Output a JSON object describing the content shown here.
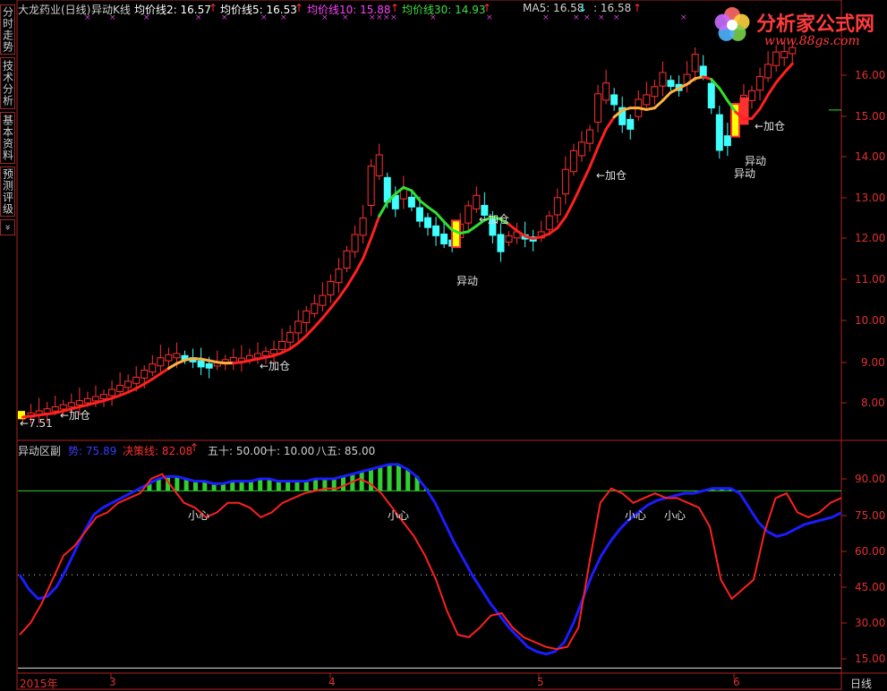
{
  "app": {
    "stock_title": "大龙药业(日线)",
    "indicator_name": "异动K线",
    "ma_values": [
      {
        "label": "均价线2: 16.57",
        "color": "#ffffff"
      },
      {
        "label": "均价线5: 16.53",
        "color": "#ffffff"
      },
      {
        "label": "均价线10: 15.88",
        "color": "#ff40ff"
      },
      {
        "label": "均价线30: 14.93",
        "color": "#40e040"
      }
    ],
    "ma5_label": "MA5: 16.58",
    "ma5_value2": ": 16.58",
    "timeframe_label": "日线"
  },
  "side_tabs": [
    {
      "label": "分时走势"
    },
    {
      "label": "技术分析"
    },
    {
      "label": "基本资料"
    },
    {
      "label": "预测评级"
    },
    {
      "label": "»"
    }
  ],
  "logo": {
    "text": "分析家公式网",
    "url": "www.88gs.com"
  },
  "price_axis": {
    "labels": [
      "16.00",
      "15.00",
      "14.00",
      "13.00",
      "12.00",
      "11.00",
      "10.00",
      "9.00",
      "8.00"
    ]
  },
  "price_annotations": {
    "low_price": "←7.51",
    "add_position": "←加仓",
    "anomaly": "异动"
  },
  "indicator_panel": {
    "title": "异动区副",
    "trend_label": "势: 75.89",
    "decision_label": "决策线: 82.08",
    "fifty_label": "五十: 50.00",
    "ten_label": "十: 10.00",
    "eightyfive_label": "八五: 85.00",
    "caution": "小心",
    "axis_labels": [
      "90.00",
      "75.00",
      "60.00",
      "45.00",
      "30.00",
      "15.00"
    ]
  },
  "x_axis": {
    "labels": [
      "2015年",
      "3",
      "4",
      "5",
      "6"
    ]
  },
  "colors": {
    "up": "#ff3030",
    "down": "#40ffff",
    "ma_red": "#ff2020",
    "ma_green": "#30e030",
    "ma_orange": "#ffb040",
    "trend_blue": "#1c1cff",
    "decision_red": "#ff2020",
    "level_green": "#30d030",
    "frame": "#b02020"
  }
}
